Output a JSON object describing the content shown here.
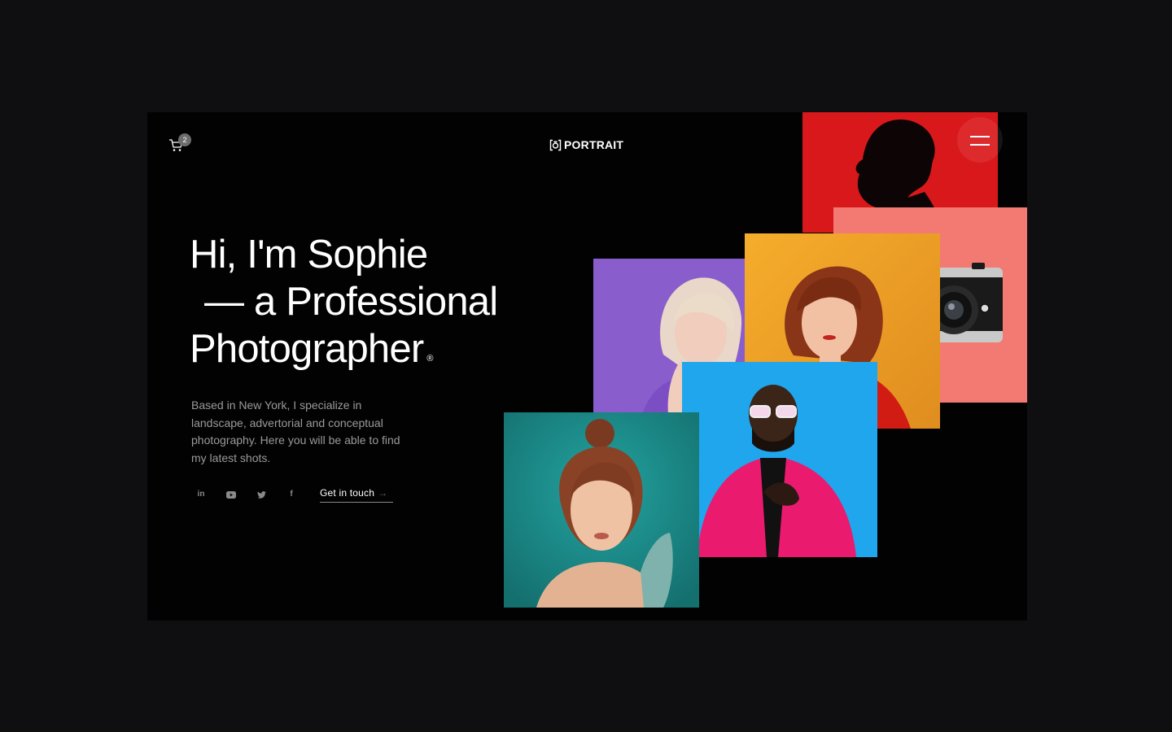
{
  "header": {
    "cart_count": "2",
    "logo_text": "PORTRAIT"
  },
  "hero": {
    "line1": "Hi, I'm Sophie",
    "line2": "— a Professional",
    "line3": "Photographer",
    "mark": "®",
    "description": "Based in New York, I specialize in landscape, advertorial and conceptual photography. Here you will be able to find my latest shots.",
    "cta_label": "Get in touch",
    "cta_arrow": "→"
  },
  "social": [
    {
      "icon": "linkedin-icon",
      "glyph": "in"
    },
    {
      "icon": "youtube-icon",
      "glyph": "▶"
    },
    {
      "icon": "twitter-icon",
      "glyph": "🐦"
    },
    {
      "icon": "facebook-icon",
      "glyph": "f"
    }
  ],
  "gallery": [
    {
      "name": "photo-red-profile",
      "bg": "#e0191b"
    },
    {
      "name": "photo-camera",
      "bg": "#f27b73"
    },
    {
      "name": "photo-orange-woman",
      "bg": "#f0a127"
    },
    {
      "name": "photo-purple-woman",
      "bg": "#8a5ccc"
    },
    {
      "name": "photo-blue-man",
      "bg": "#1fa3e8"
    },
    {
      "name": "photo-teal-woman",
      "bg": "#1f8f8d"
    }
  ]
}
